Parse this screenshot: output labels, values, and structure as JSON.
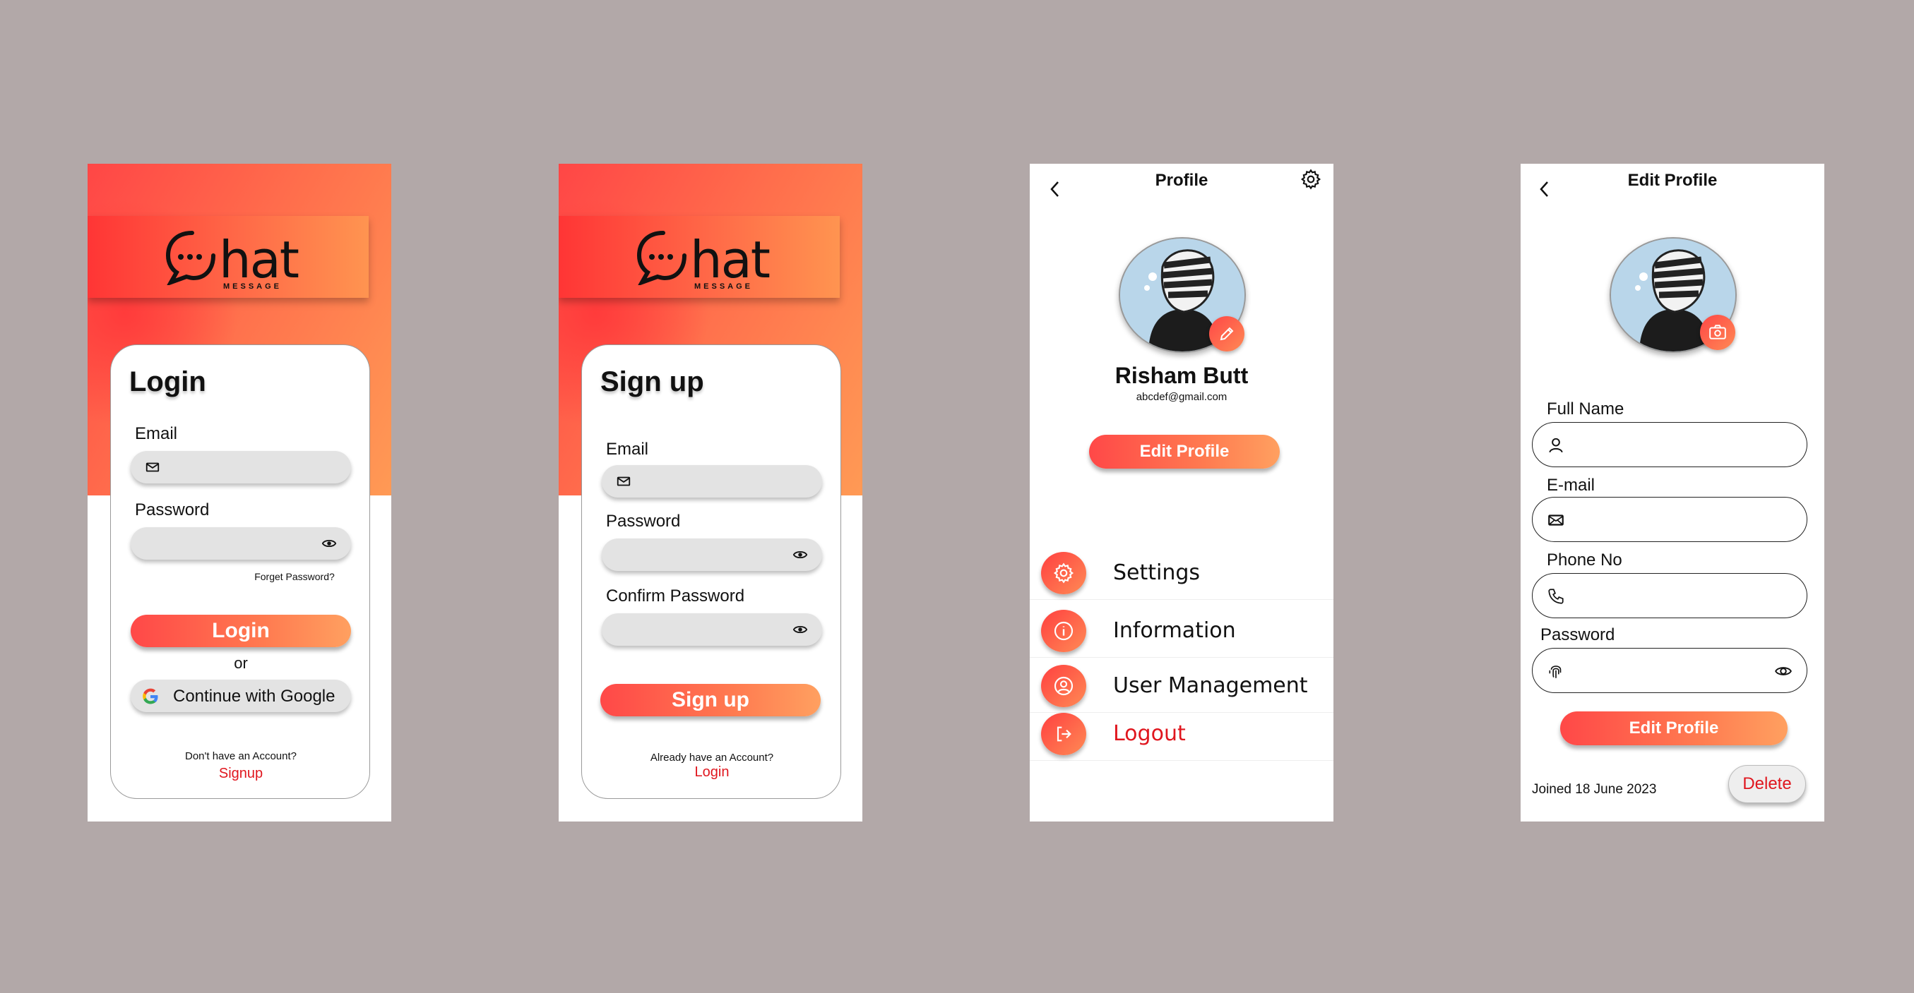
{
  "login": {
    "logo_text": "hat",
    "logo_sub": "MESSAGE",
    "title": "Login",
    "email_label": "Email",
    "password_label": "Password",
    "forget_password": "Forget Password?",
    "login_button": "Login",
    "or_text": "or",
    "google_button": "Continue with Google",
    "no_account": "Don't have an Account?",
    "signup_link": "Signup"
  },
  "signup": {
    "logo_text": "hat",
    "logo_sub": "MESSAGE",
    "title": "Sign up",
    "email_label": "Email",
    "password_label": "Password",
    "confirm_label": "Confirm Password",
    "signup_button": "Sign up",
    "have_account": "Already have an Account?",
    "login_link": "Login"
  },
  "profile": {
    "header_title": "Profile",
    "name": "Risham Butt",
    "email": "abcdef@gmail.com",
    "edit_button": "Edit Profile",
    "menu": [
      {
        "label": "Settings",
        "icon": "gear-icon"
      },
      {
        "label": "Information",
        "icon": "info-icon"
      },
      {
        "label": "User Management",
        "icon": "user-gear-icon"
      },
      {
        "label": "Logout",
        "icon": "logout-icon"
      }
    ]
  },
  "edit_profile": {
    "header_title": "Edit Profile",
    "full_name_label": "Full Name",
    "email_label": "E-mail",
    "phone_label": "Phone No",
    "password_label": "Password",
    "edit_button": "Edit Profile",
    "joined": "Joined 18 June 2023",
    "delete_button": "Delete"
  },
  "colors": {
    "accent_red": "#ff4646",
    "accent_orange": "#ff9a55",
    "link_red": "#e0161e",
    "background": "#b2a8a8"
  }
}
